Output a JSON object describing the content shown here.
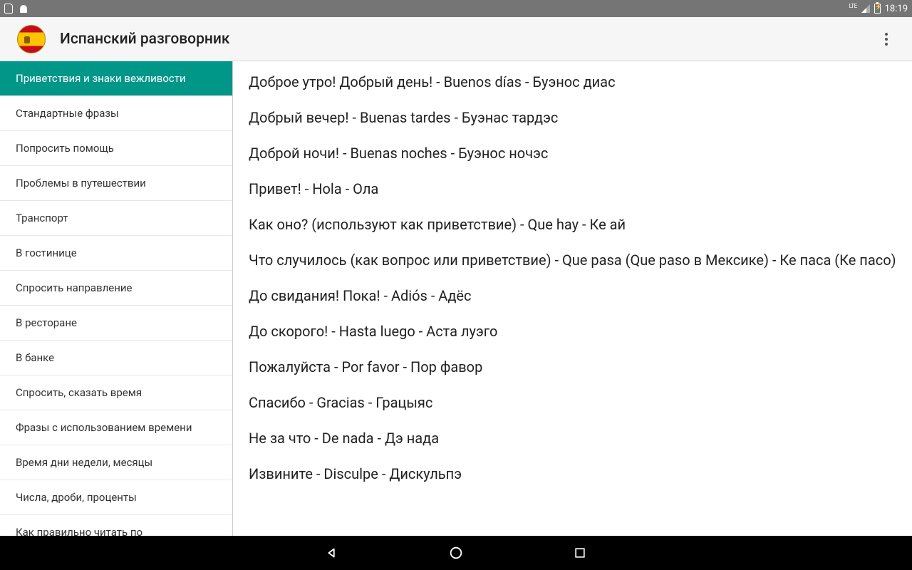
{
  "status": {
    "time": "18:19"
  },
  "appbar": {
    "title": "Испанский разговорник"
  },
  "sidebar": {
    "items": [
      {
        "label": "Приветствия и знаки вежливости",
        "active": true
      },
      {
        "label": "Стандартные фразы"
      },
      {
        "label": "Попросить помощь"
      },
      {
        "label": "Проблемы в путешествии"
      },
      {
        "label": "Транспорт"
      },
      {
        "label": "В гостинице"
      },
      {
        "label": "Спросить направление"
      },
      {
        "label": "В ресторане"
      },
      {
        "label": "В банке"
      },
      {
        "label": "Спросить, сказать время"
      },
      {
        "label": "Фразы с использованием времени"
      },
      {
        "label": "Время дни недели, месяцы"
      },
      {
        "label": "Числа, дроби, проценты"
      },
      {
        "label": "Как правильно читать по"
      }
    ]
  },
  "phrases": [
    "Доброе утро! Добрый день! - Buenos días - Буэнос диас",
    "Добрый вечер! - Buenas tardes - Буэнас тардэс",
    "Доброй ночи! - Buenas noches - Буэнос ночэс",
    "Привет! - Hola - Ола",
    "Как оно? (используют как приветствие) - Que hay - Ке ай",
    "Что случилось (как вопрос или приветствие) - Que pasa (Que paso в Мексике) - Ке паса (Ке пасо)",
    "До свидания! Пока! - Adiós - Адёс",
    "До скорого! - Hasta luego - Аста луэго",
    "Пожалуйста - Por favor - Пор фавор",
    "Спасибо - Gracias - Грацыяс",
    "Не за что - De nada - Дэ нада",
    "Извините - Disculpe - Дискульпэ"
  ]
}
